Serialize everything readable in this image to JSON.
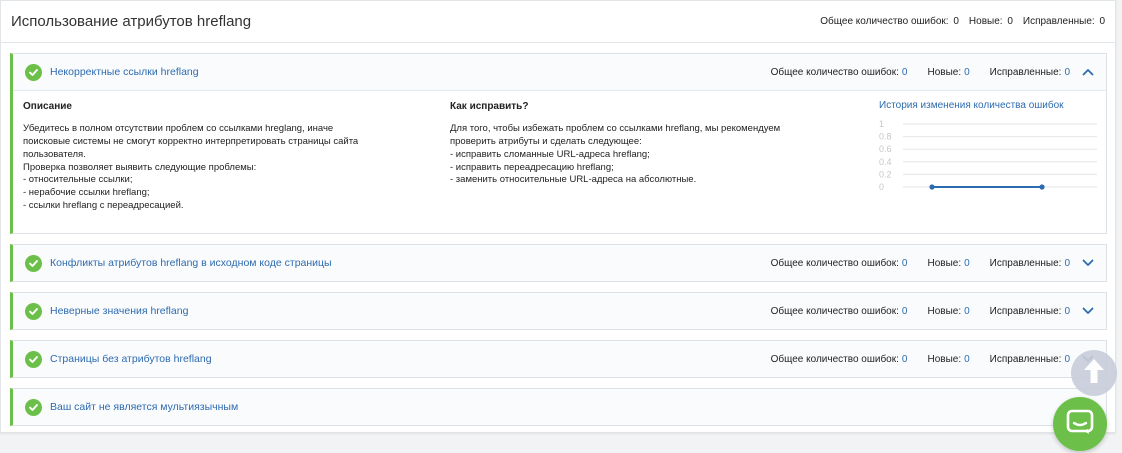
{
  "header": {
    "title": "Использование атрибутов hreflang",
    "summary_total_label": "Общее количество ошибок:",
    "summary_total": "0",
    "summary_new_label": "Новые:",
    "summary_new": "0",
    "summary_fixed_label": "Исправленные:",
    "summary_fixed": "0"
  },
  "labels": {
    "total": "Общее количество ошибок:",
    "new": "Новые:",
    "fixed": "Исправленные:"
  },
  "checks": [
    {
      "title": "Некорректные ссылки hreflang",
      "total": "0",
      "new": "0",
      "fixed": "0",
      "expanded": true
    },
    {
      "title": "Конфликты атрибутов hreflang в исходном коде страницы",
      "total": "0",
      "new": "0",
      "fixed": "0",
      "expanded": false
    },
    {
      "title": "Неверные значения hreflang",
      "total": "0",
      "new": "0",
      "fixed": "0",
      "expanded": false
    },
    {
      "title": "Страницы без атрибутов hreflang",
      "total": "0",
      "new": "0",
      "fixed": "0",
      "expanded": false
    },
    {
      "title": "Ваш сайт не является мультиязычным"
    }
  ],
  "details": {
    "desc_title": "Описание",
    "desc_lines": [
      "Убедитесь в полном отсутствии проблем со ссылками hreglang, иначе",
      "поисковые системы не смогут корректно интерпретировать страницы сайта",
      "пользователя.",
      "Проверка позволяет выявить следующие проблемы:",
      "- относительные ссылки;",
      "- нерабочие ссылки hreflang;",
      "- ссылки hreflang с переадресацией."
    ],
    "fix_title": "Как исправить?",
    "fix_lines": [
      "Для того, чтобы избежать проблем со ссылками hreflang, мы рекомендуем",
      "проверить атрибуты и сделать следующее:",
      "- исправить сломанные URL-адреса hreflang;",
      "- исправить переадресацию hreflang;",
      "- заменить относительные URL-адреса на абсолютные."
    ],
    "history_title": "История изменения количества ошибок"
  },
  "chart_data": {
    "type": "line",
    "yticks": [
      "1",
      "0.8",
      "0.6",
      "0.4",
      "0.2",
      "0"
    ],
    "ylim": [
      0,
      1
    ],
    "series": [
      {
        "values": [
          0,
          0
        ]
      }
    ],
    "color": "#2d6bb0"
  },
  "colors": {
    "accent": "#2d6bb0",
    "success": "#6cc04a"
  },
  "icons": {
    "ok": "check-circle-icon",
    "up": "arrow-up-icon",
    "chat": "chat-icon"
  }
}
